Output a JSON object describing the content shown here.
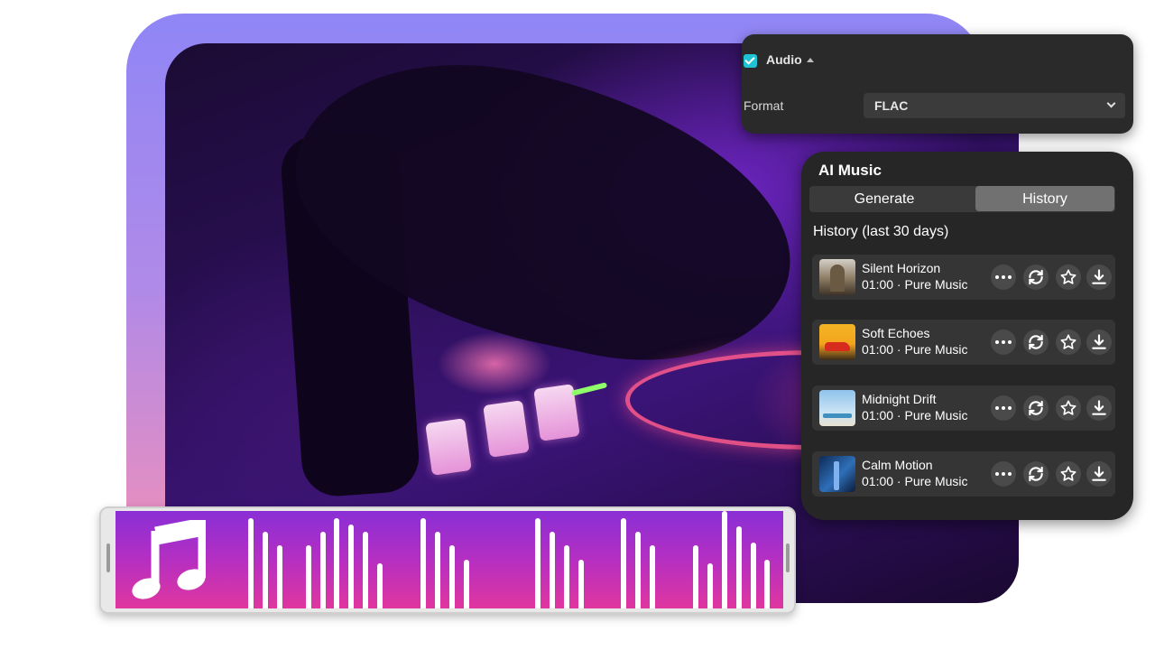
{
  "audio_panel": {
    "enabled": true,
    "title": "Audio",
    "format_label": "Format",
    "format_value": "FLAC"
  },
  "ai_music": {
    "title": "AI Music",
    "tabs": [
      {
        "label": "Generate",
        "active": false
      },
      {
        "label": "History",
        "active": true
      }
    ],
    "history_heading": "History (last 30 days)",
    "tracks": [
      {
        "title": "Silent Horizon",
        "meta": "01:00 · Pure Music",
        "thumb_icon": "building-thumbnail"
      },
      {
        "title": "Soft Echoes",
        "meta": "01:00 · Pure Music",
        "thumb_icon": "red-car-thumbnail"
      },
      {
        "title": "Midnight Drift",
        "meta": "01:00 · Pure Music",
        "thumb_icon": "seagull-beach-thumbnail"
      },
      {
        "title": "Calm Motion",
        "meta": "01:00 · Pure Music",
        "thumb_icon": "city-night-thumbnail"
      }
    ]
  },
  "waveform": {
    "icon": "music-note-icon",
    "gradient": [
      "#8a2fd6",
      "#e0369f"
    ],
    "bar_levels": [
      0.93,
      0.79,
      0.65,
      0,
      0.65,
      0.79,
      0.93,
      0.86,
      0.79,
      0.46,
      0,
      0,
      0.93,
      0.79,
      0.65,
      0.5,
      0,
      0,
      0,
      0,
      0.93,
      0.79,
      0.65,
      0.5,
      0,
      0,
      0.93,
      0.79,
      0.65,
      0,
      0,
      0.65,
      0.46,
      1.0,
      0.84,
      0.68,
      0.5
    ]
  },
  "colors": {
    "accent": "#1fc3d3",
    "panel_bg": "#262626",
    "frame_gradient_top": "#8f86f6",
    "frame_gradient_bottom": "#f08fb8"
  }
}
